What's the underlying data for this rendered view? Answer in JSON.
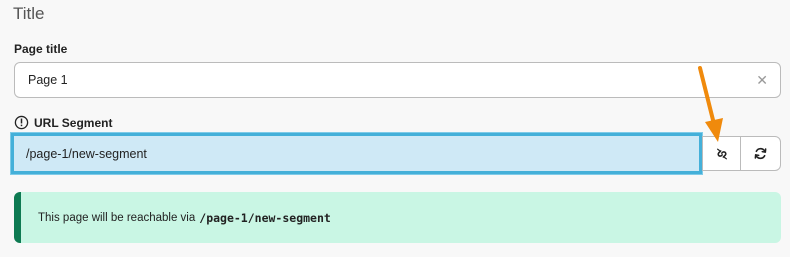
{
  "section": {
    "title": "Title"
  },
  "page_title": {
    "label": "Page title",
    "value": "Page 1"
  },
  "url_segment": {
    "label": "URL Segment",
    "value": "/page-1/new-segment"
  },
  "notice": {
    "text": "This page will be reachable via",
    "url": "/page-1/new-segment"
  },
  "colors": {
    "accent": "#44b0d9",
    "notice_bg": "#c9f6e4",
    "notice_border": "#0e7a52",
    "arrow": "#f08a0c"
  },
  "icons": [
    "warning-icon",
    "clear-icon",
    "unlink-icon",
    "refresh-icon",
    "arrow-annotation"
  ]
}
